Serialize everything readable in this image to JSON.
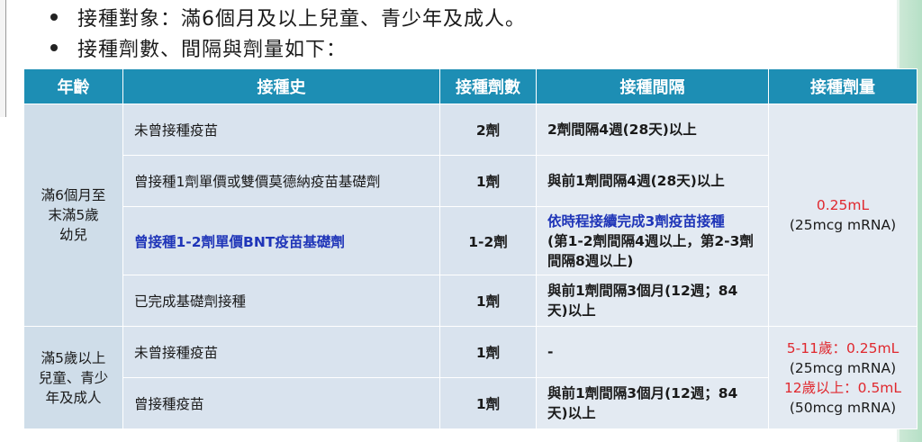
{
  "bullets": [
    "接種對象：滿6個月及以上兒童、青少年及成人。",
    "接種劑數、間隔與劑量如下："
  ],
  "table": {
    "headers": [
      "年齡",
      "接種史",
      "接種劑數",
      "接種間隔",
      "接種劑量"
    ],
    "group1": {
      "age_lines": [
        "滿6個月至",
        "末滿5歲",
        "幼兒"
      ],
      "rows": [
        {
          "history": "未曾接種疫苗",
          "doses": "2劑",
          "interval": "2劑間隔4週(28天)以上"
        },
        {
          "history": "曾接種1劑單價或雙價莫德納疫苗基礎劑",
          "doses": "1劑",
          "interval": "與前1劑間隔4週(28天)以上"
        },
        {
          "history": "曾接種1-2劑單價BNT疫苗基礎劑",
          "doses": "1-2劑",
          "interval_title": "依時程接續完成3劑疫苗接種",
          "interval": "(第1-2劑間隔4週以上，第2-3劑間隔8週以上)"
        },
        {
          "history": "已完成基礎劑接種",
          "doses": "1劑",
          "interval": "與前1劑間隔3個月(12週；84天)以上"
        }
      ],
      "amount": "0.25mL",
      "amount_sub": "(25mcg mRNA)"
    },
    "group2": {
      "age_lines": [
        "滿5歲以上",
        "兒童、青少",
        "年及成人"
      ],
      "rows": [
        {
          "history": "未曾接種疫苗",
          "doses": "1劑",
          "interval": "-"
        },
        {
          "history": "曾接種疫苗",
          "doses": "1劑",
          "interval": "與前1劑間隔3個月(12週；84天)以上"
        }
      ],
      "amount1": "5-11歲：0.25mL",
      "amount1_sub": "(25mcg mRNA)",
      "amount2": "12歲以上：0.5mL",
      "amount2_sub": "(50mcg mRNA)"
    }
  },
  "colors": {
    "header": "#1d8eb4",
    "highlight_blue": "#1f35b8",
    "dose_red": "#e0282e"
  }
}
